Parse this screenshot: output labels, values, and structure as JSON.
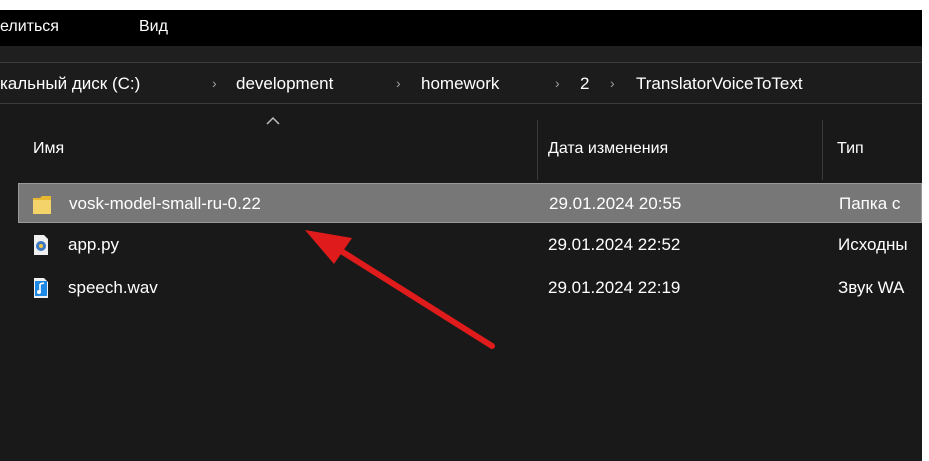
{
  "menu": {
    "share_label": "елиться",
    "view_label": "Вид"
  },
  "breadcrumb": {
    "items": [
      "кальный диск (C:)",
      "development",
      "homework",
      "2",
      "TranslatorVoiceToText"
    ],
    "separator": "›"
  },
  "columns": {
    "name": "Имя",
    "date": "Дата изменения",
    "type": "Тип"
  },
  "files": [
    {
      "name": "vosk-model-small-ru-0.22",
      "date": "29.01.2024 20:55",
      "type": "Папка с",
      "icon": "folder-icon",
      "selected": true
    },
    {
      "name": "app.py",
      "date": "29.01.2024 22:52",
      "type": "Исходны",
      "icon": "python-file-icon",
      "selected": false
    },
    {
      "name": "speech.wav",
      "date": "29.01.2024 22:19",
      "type": "Звук WA",
      "icon": "audio-file-icon",
      "selected": false
    }
  ],
  "annotation": {
    "arrow_color": "#e01b1b"
  },
  "colors": {
    "window_bg": "#191919",
    "menubar_bg": "#000000",
    "selection_bg": "#777777",
    "folder_yellow": "#f2c94c"
  }
}
